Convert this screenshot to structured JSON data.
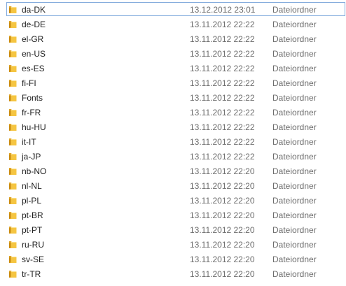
{
  "icon": "folder-icon",
  "colors": {
    "focus_border": "#84acdd",
    "folder_front": "#f5c542",
    "folder_back": "#e0a526",
    "meta_text": "#6d6d6d"
  },
  "files": [
    {
      "name": "da-DK",
      "date": "13.12.2012 23:01",
      "type": "Dateiordner",
      "focused": true
    },
    {
      "name": "de-DE",
      "date": "13.11.2012 22:22",
      "type": "Dateiordner"
    },
    {
      "name": "el-GR",
      "date": "13.11.2012 22:22",
      "type": "Dateiordner"
    },
    {
      "name": "en-US",
      "date": "13.11.2012 22:22",
      "type": "Dateiordner"
    },
    {
      "name": "es-ES",
      "date": "13.11.2012 22:22",
      "type": "Dateiordner"
    },
    {
      "name": "fi-FI",
      "date": "13.11.2012 22:22",
      "type": "Dateiordner"
    },
    {
      "name": "Fonts",
      "date": "13.11.2012 22:22",
      "type": "Dateiordner"
    },
    {
      "name": "fr-FR",
      "date": "13.11.2012 22:22",
      "type": "Dateiordner"
    },
    {
      "name": "hu-HU",
      "date": "13.11.2012 22:22",
      "type": "Dateiordner"
    },
    {
      "name": "it-IT",
      "date": "13.11.2012 22:22",
      "type": "Dateiordner"
    },
    {
      "name": "ja-JP",
      "date": "13.11.2012 22:22",
      "type": "Dateiordner"
    },
    {
      "name": "nb-NO",
      "date": "13.11.2012 22:20",
      "type": "Dateiordner"
    },
    {
      "name": "nl-NL",
      "date": "13.11.2012 22:20",
      "type": "Dateiordner"
    },
    {
      "name": "pl-PL",
      "date": "13.11.2012 22:20",
      "type": "Dateiordner"
    },
    {
      "name": "pt-BR",
      "date": "13.11.2012 22:20",
      "type": "Dateiordner"
    },
    {
      "name": "pt-PT",
      "date": "13.11.2012 22:20",
      "type": "Dateiordner"
    },
    {
      "name": "ru-RU",
      "date": "13.11.2012 22:20",
      "type": "Dateiordner"
    },
    {
      "name": "sv-SE",
      "date": "13.11.2012 22:20",
      "type": "Dateiordner"
    },
    {
      "name": "tr-TR",
      "date": "13.11.2012 22:20",
      "type": "Dateiordner"
    }
  ]
}
